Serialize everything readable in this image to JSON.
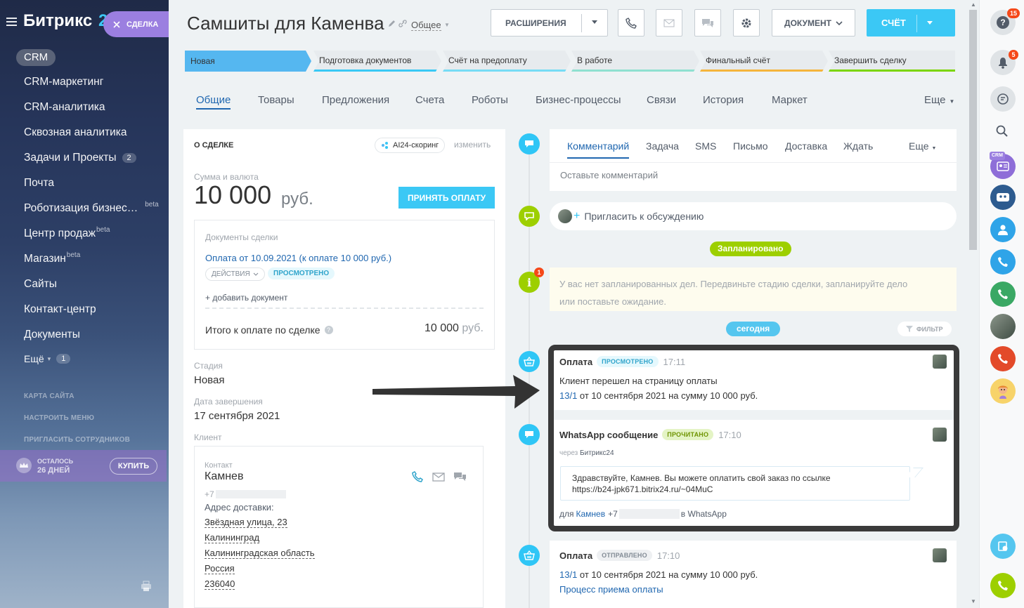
{
  "sidebar": {
    "logo_main": "Битрикс",
    "logo_tail": "24",
    "deal_chip": "СДЕЛКА",
    "crm_label": "CRM",
    "items": [
      {
        "label": "CRM-маркетинг"
      },
      {
        "label": "CRM-аналитика"
      },
      {
        "label": "Сквозная аналитика"
      },
      {
        "label": "Задачи и Проекты",
        "badge": "2"
      },
      {
        "label": "Почта"
      },
      {
        "label": "Роботизация бизнес…",
        "sup": "beta"
      },
      {
        "label": "Центр продаж",
        "sup": "beta"
      },
      {
        "label": "Магазин",
        "sup": "beta"
      },
      {
        "label": "Сайты"
      },
      {
        "label": "Контакт-центр"
      },
      {
        "label": "Документы"
      },
      {
        "label": "Ещё",
        "badge": "1"
      }
    ],
    "links": [
      "КАРТА САЙТА",
      "НАСТРОИТЬ МЕНЮ",
      "ПРИГЛАСИТЬ СОТРУДНИКОВ"
    ],
    "trial_line1": "ОСТАЛОСЬ",
    "trial_line2": "26 ДНЕЙ",
    "buy": "КУПИТЬ"
  },
  "header": {
    "title": "Самшиты для  Каменва",
    "category": "Общее",
    "extensions": "РАСШИРЕНИЯ",
    "document": "ДОКУМЕНТ",
    "invoice": "СЧЁТ"
  },
  "stages": [
    {
      "label": "Новая",
      "color": "#55b7f0",
      "active": true
    },
    {
      "label": "Подготовка документов",
      "color": "#39c9f5"
    },
    {
      "label": "Счёт на предоплату",
      "color": "#76dcf5"
    },
    {
      "label": "В работе",
      "color": "#8fe0d0"
    },
    {
      "label": "Финальный счёт",
      "color": "#f5b53c"
    },
    {
      "label": "Завершить сделку",
      "color": "#7bd500"
    }
  ],
  "tabs": [
    "Общие",
    "Товары",
    "Предложения",
    "Счета",
    "Роботы",
    "Бизнес-процессы",
    "Связи",
    "История",
    "Маркет",
    "Еще"
  ],
  "deal": {
    "section": "О СДЕЛКЕ",
    "scoring": "AI24-скоринг",
    "edit": "изменить",
    "amount_label": "Сумма и валюта",
    "amount": "10 000",
    "currency": "руб.",
    "accept_payment": "ПРИНЯТЬ ОПЛАТУ",
    "docs_label": "Документы сделки",
    "doc_link": "Оплата от 10.09.2021 (к оплате 10 000 руб.)",
    "actions": "ДЕЙСТВИЯ",
    "viewed": "ПРОСМОТРЕНО",
    "add_doc": "+ добавить документ",
    "total_label": "Итого к оплате по сделке",
    "total_value": "10 000",
    "total_currency": "руб.",
    "stage_label": "Стадия",
    "stage_value": "Новая",
    "close_label": "Дата завершения",
    "close_value": "17 сентября 2021",
    "client_label": "Клиент",
    "contact_label": "Контакт",
    "contact_name": "Камнев",
    "phone_prefix": "+7",
    "address_label": "Адрес доставки:",
    "address": [
      "Звёздная улица, 23",
      "Калининград",
      "Калининградская область",
      "Россия",
      "236040"
    ]
  },
  "timeline": {
    "tabs": [
      "Комментарий",
      "Задача",
      "SMS",
      "Письмо",
      "Доставка",
      "Ждать",
      "Еще"
    ],
    "comment_placeholder": "Оставьте комментарий",
    "invite": "Пригласить к обсуждению",
    "planned": "Запланировано",
    "notice_count": "1",
    "notice_line1": "У вас нет запланированных дел. Передвиньте стадию сделки, запланируйте дело",
    "notice_line2": "или поставьте ожидание.",
    "today": "сегодня",
    "filter": "ФИЛЬТР",
    "events": [
      {
        "title": "Оплата",
        "status": "ПРОСМОТРЕНО",
        "time": "17:11",
        "line1": "Клиент перешел на страницу оплаты",
        "link": "13/1",
        "line2": " от 10 сентября 2021 на сумму 10 000 руб."
      },
      {
        "title": "WhatsApp сообщение",
        "status": "ПРОЧИТАНО",
        "time": "17:10",
        "via_prefix": "через ",
        "via": "Битрикс24",
        "bubble1": "Здравствуйте, Камнев. Вы можете оплатить свой заказ по ссылке",
        "bubble2": "https://b24-jpk671.bitrix24.ru/~04MuC",
        "to_prefix": "для ",
        "to_name": "Камнев",
        "to_phone": "+7",
        "to_suffix": " в WhatsApp"
      },
      {
        "title": "Оплата",
        "status": "ОТПРАВЛЕНО",
        "time": "17:10",
        "link": "13/1",
        "line2": " от 10 сентября 2021 на сумму 10 000 руб.",
        "process": "Процесс приема оплаты"
      }
    ]
  },
  "right_panel": {
    "help_badge": "15",
    "notify_badge": "5",
    "crm_tag": "CRM"
  }
}
